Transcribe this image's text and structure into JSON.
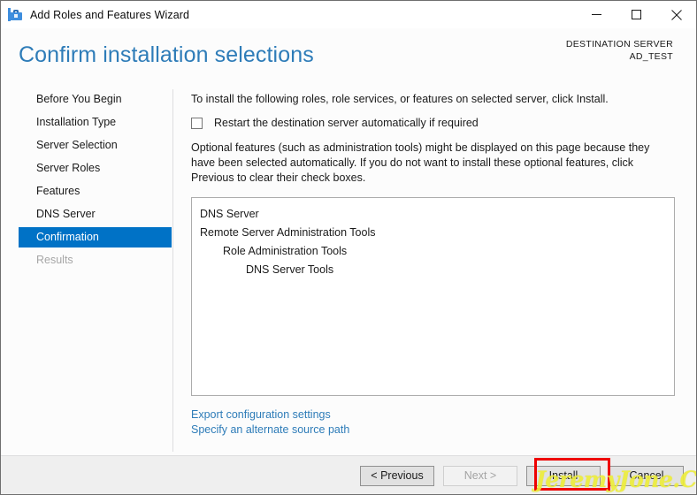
{
  "window": {
    "title": "Add Roles and Features Wizard",
    "icon": "toolbox-icon",
    "minimize_label": "Minimize",
    "maximize_label": "Maximize",
    "close_label": "Close"
  },
  "header": {
    "page_title": "Confirm installation selections",
    "destination_label": "DESTINATION SERVER",
    "destination_value": "AD_TEST",
    "accent_color": "#2e7cb8"
  },
  "sidebar": {
    "items": [
      {
        "label": "Before You Begin",
        "state": "normal"
      },
      {
        "label": "Installation Type",
        "state": "normal"
      },
      {
        "label": "Server Selection",
        "state": "normal"
      },
      {
        "label": "Server Roles",
        "state": "normal"
      },
      {
        "label": "Features",
        "state": "normal"
      },
      {
        "label": "DNS Server",
        "state": "normal"
      },
      {
        "label": "Confirmation",
        "state": "selected"
      },
      {
        "label": "Results",
        "state": "disabled"
      }
    ],
    "selected_color": "#0072c6"
  },
  "content": {
    "intro_text": "To install the following roles, role services, or features on selected server, click Install.",
    "restart_checkbox_label": "Restart the destination server automatically if required",
    "restart_checkbox_checked": false,
    "optional_text": "Optional features (such as administration tools) might be displayed on this page because they have been selected automatically. If you do not want to install these optional features, click Previous to clear their check boxes.",
    "selections": [
      {
        "label": "DNS Server",
        "indent": 1
      },
      {
        "label": "Remote Server Administration Tools",
        "indent": 1
      },
      {
        "label": "Role Administration Tools",
        "indent": 2
      },
      {
        "label": "DNS Server Tools",
        "indent": 3
      }
    ],
    "links": [
      {
        "label": "Export configuration settings"
      },
      {
        "label": "Specify an alternate source path"
      }
    ]
  },
  "footer": {
    "previous_label": "< Previous",
    "next_label": "Next >",
    "install_label": "Install",
    "cancel_label": "Cancel",
    "next_enabled": false
  },
  "annotation": {
    "highlight_color": "#ee0000",
    "highlight_target": "Install",
    "watermark_text": "JeremyJone.COM",
    "watermark_color": "#eded3c"
  }
}
